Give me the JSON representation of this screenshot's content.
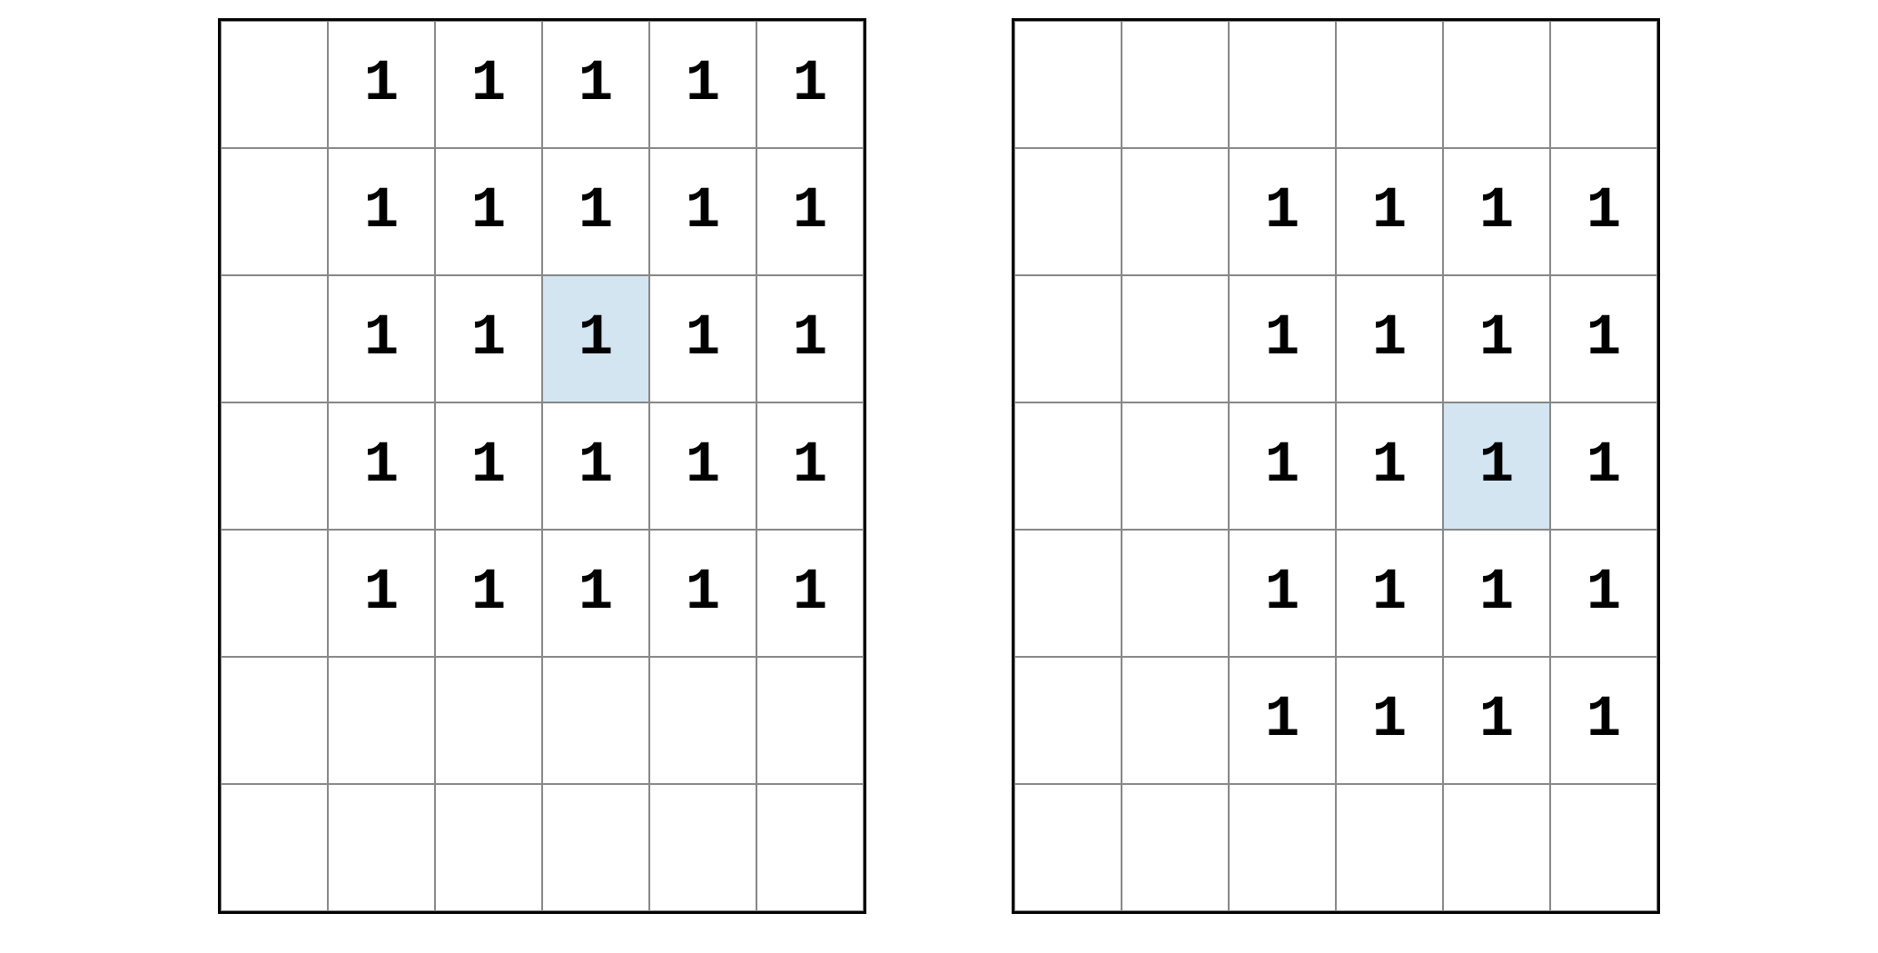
{
  "grids": [
    {
      "rows": 7,
      "cols": 6,
      "cells": [
        [
          "",
          "1",
          "1",
          "1",
          "1",
          "1"
        ],
        [
          "",
          "1",
          "1",
          "1",
          "1",
          "1"
        ],
        [
          "",
          "1",
          "1",
          "1",
          "1",
          "1"
        ],
        [
          "",
          "1",
          "1",
          "1",
          "1",
          "1"
        ],
        [
          "",
          "1",
          "1",
          "1",
          "1",
          "1"
        ],
        [
          "",
          "",
          "",
          "",
          "",
          ""
        ],
        [
          "",
          "",
          "",
          "",
          "",
          ""
        ]
      ],
      "highlight": {
        "row": 2,
        "col": 3
      }
    },
    {
      "rows": 7,
      "cols": 6,
      "cells": [
        [
          "",
          "",
          "",
          "",
          "",
          ""
        ],
        [
          "",
          "",
          "1",
          "1",
          "1",
          "1"
        ],
        [
          "",
          "",
          "1",
          "1",
          "1",
          "1"
        ],
        [
          "",
          "",
          "1",
          "1",
          "1",
          "1"
        ],
        [
          "",
          "",
          "1",
          "1",
          "1",
          "1"
        ],
        [
          "",
          "",
          "1",
          "1",
          "1",
          "1"
        ],
        [
          "",
          "",
          "",
          "",
          "",
          ""
        ]
      ],
      "highlight": {
        "row": 3,
        "col": 4
      }
    }
  ]
}
